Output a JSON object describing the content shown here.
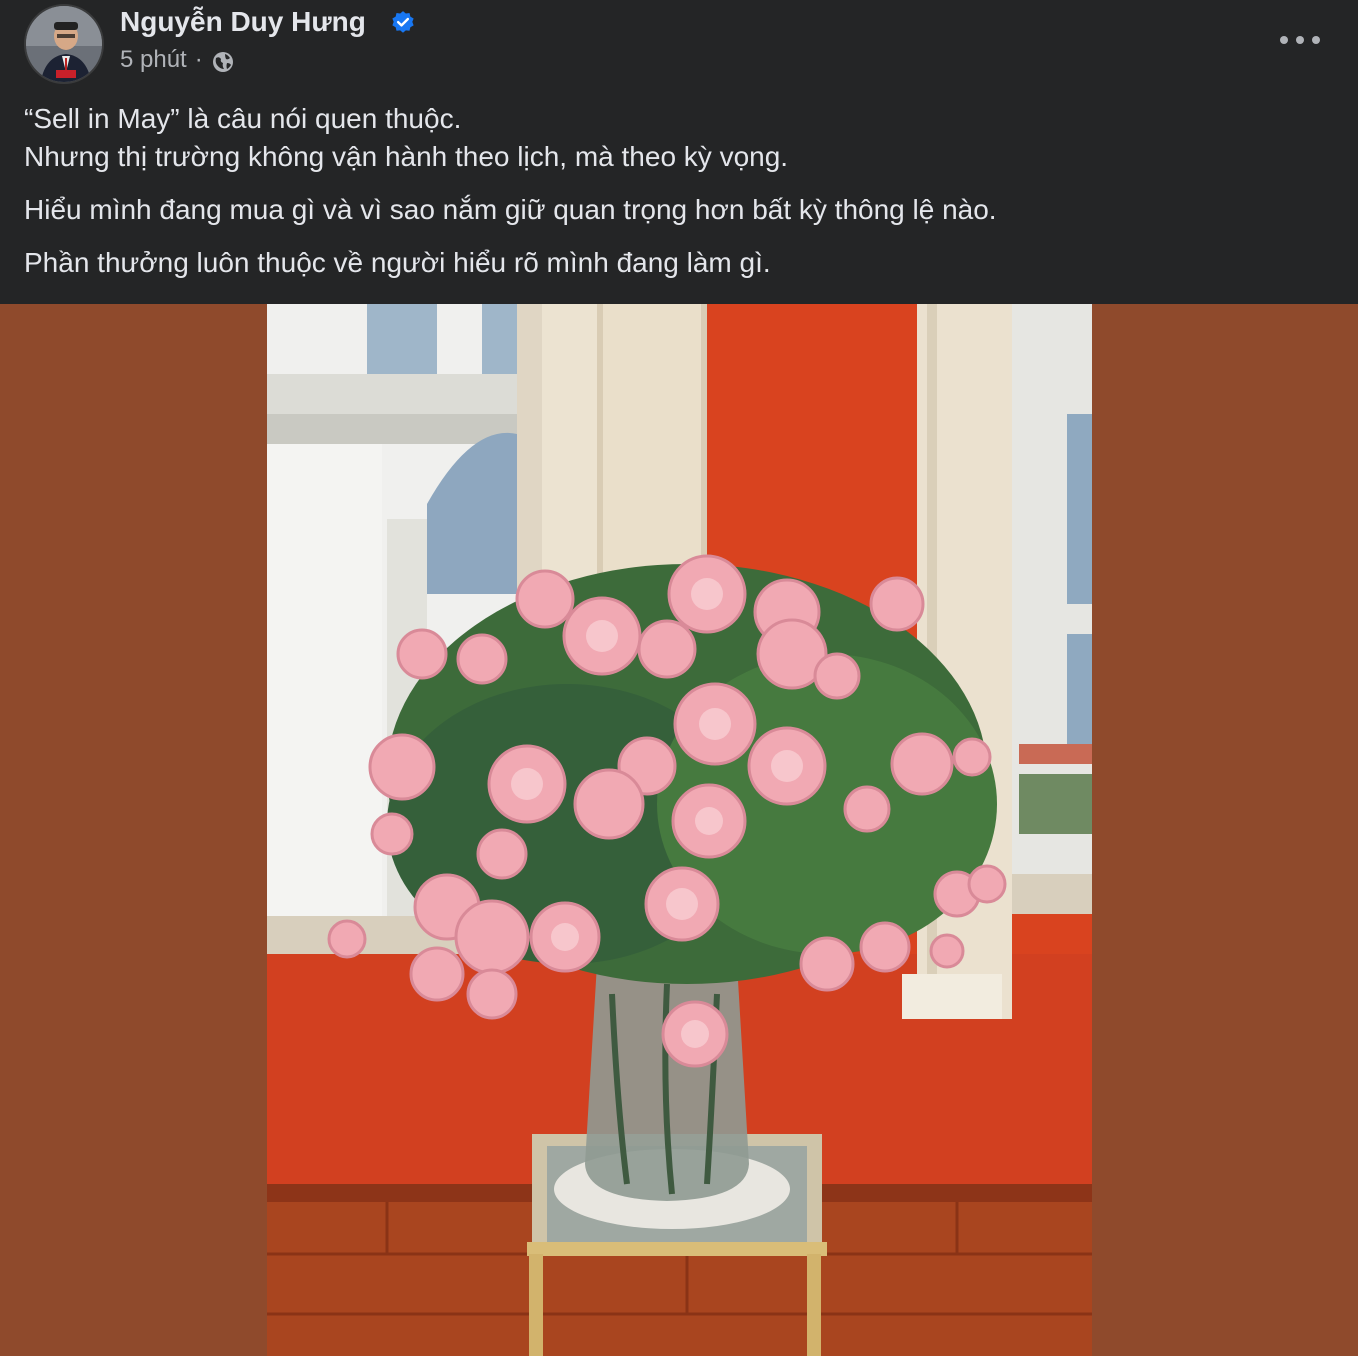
{
  "post": {
    "author": {
      "name": "Nguyễn Duy Hưng",
      "verified": true,
      "avatar_icon": "profile-photo"
    },
    "meta": {
      "time": "5 phút",
      "separator": "·",
      "audience_icon": "globe-icon"
    },
    "menu_icon": "more-options-icon",
    "text_lines": [
      "“Sell in May” là câu nói quen thuộc.",
      "Nhưng thị trường không vận hành theo lịch, mà theo kỳ vọng.",
      "Hiểu mình đang mua gì và vì sao nắm giữ quan trọng hơn bất kỳ thông lệ nào.",
      "Phần thưởng luôn thuộc về người hiểu rõ mình đang làm gì."
    ],
    "photo_icon": "rose-bouquet-photo"
  },
  "colors": {
    "background": "#242526",
    "text_primary": "#e4e6eb",
    "text_secondary": "#b0b3b8",
    "verified_blue": "#1877f2",
    "media_backdrop": "#8f4a2c",
    "wall_red": "#d9431f"
  }
}
